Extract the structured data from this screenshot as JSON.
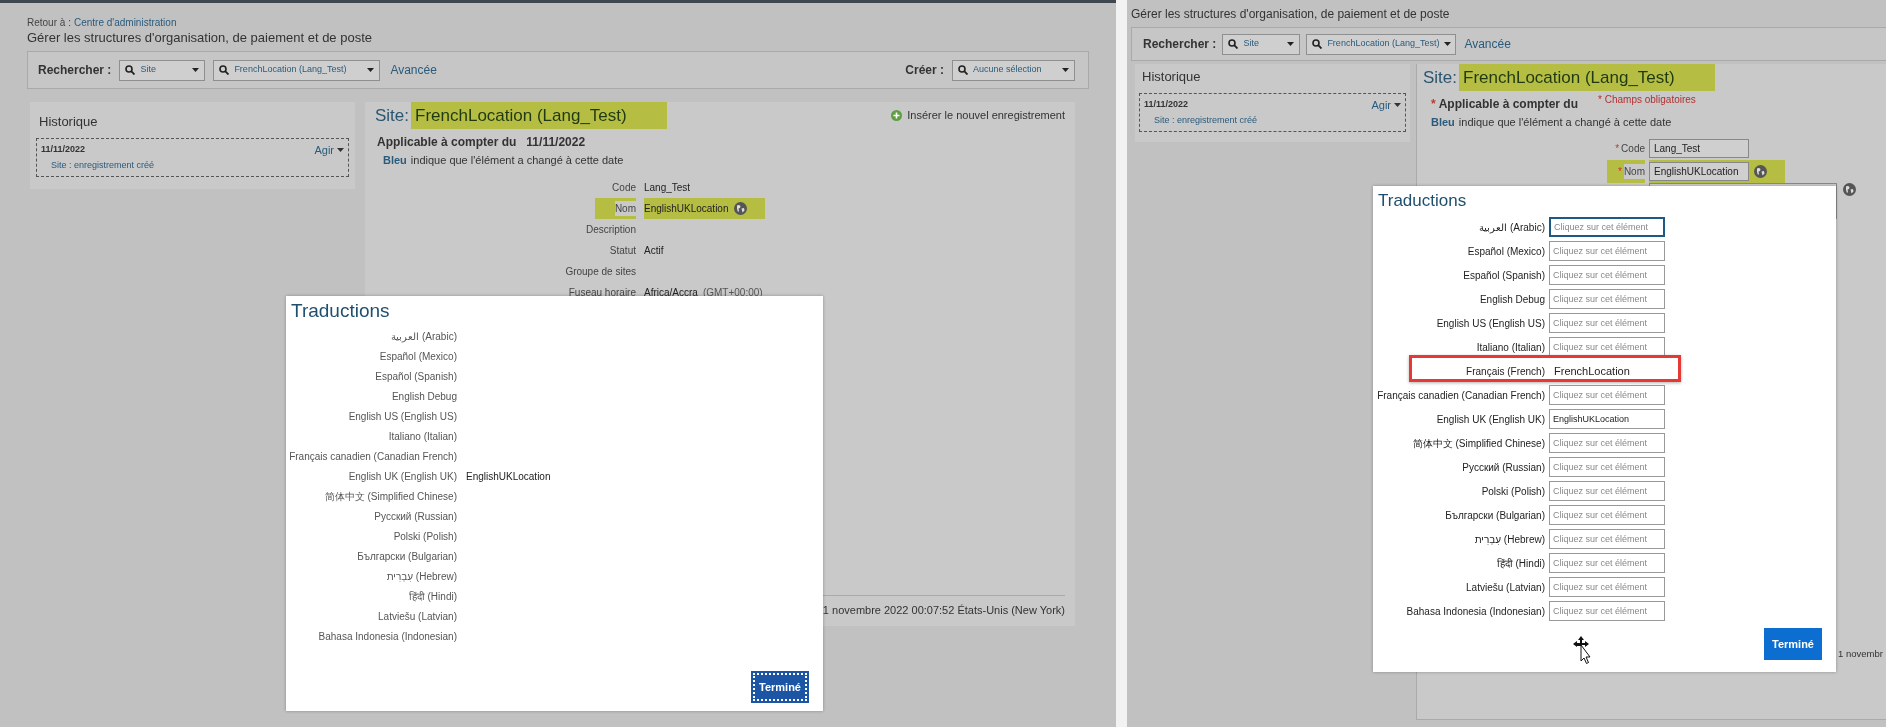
{
  "screenshots": [
    {
      "kind": "read_only",
      "breadcrumb": {
        "label": "Retour à :",
        "link": "Centre d'administration"
      },
      "page_title": "Gérer les structures d'organisation, de paiement et de poste",
      "search": {
        "label": "Rechercher :",
        "type_select": "Site",
        "record_select": "FrenchLocation (Lang_Test)",
        "advanced_link": "Avancée"
      },
      "create": {
        "label": "Créer :",
        "select": "Aucune sélection"
      },
      "history": {
        "title": "Historique",
        "entries": [
          {
            "date": "11/11/2022",
            "description": "Site : enregistrement créé",
            "action": "Agir"
          }
        ]
      },
      "record": {
        "title_prefix": "Site:",
        "title": "FrenchLocation (Lang_Test)",
        "insert_action": "Insérer le nouvel enregistrement",
        "effective": {
          "label": "Applicable à compter du",
          "date": "11/11/2022"
        },
        "legend": {
          "keyword": "Bleu",
          "text": "indique que l'élément a changé à cette date"
        },
        "fields": [
          {
            "kind": "text",
            "label": "Code",
            "value": "Lang_Test",
            "highlighted": false,
            "translatable": false
          },
          {
            "kind": "text",
            "label": "Nom",
            "value": "EnglishUKLocation",
            "highlighted": true,
            "translatable": true
          },
          {
            "kind": "text",
            "label": "Description",
            "highlighted": false,
            "translatable": false
          },
          {
            "kind": "text",
            "label": "Statut",
            "value": "Actif",
            "highlighted": false,
            "translatable": false
          },
          {
            "kind": "text",
            "label": "Groupe de sites",
            "highlighted": false,
            "translatable": false
          },
          {
            "kind": "text",
            "label": "Fuseau horaire",
            "value": "Africa/Accra",
            "note": "(GMT+00:00)",
            "highlighted": false,
            "translatable": false
          }
        ],
        "footer": "1 novembre 2022 00:07:52 États-Unis (New York)"
      },
      "translations": {
        "title": "Traductions",
        "done_button": "Terminé",
        "done_focused": true,
        "rows": [
          {
            "kind": "text",
            "language": "العربية (Arabic)"
          },
          {
            "kind": "text",
            "language": "Español (Mexico)"
          },
          {
            "kind": "text",
            "language": "Español (Spanish)"
          },
          {
            "kind": "text",
            "language": "English Debug"
          },
          {
            "kind": "text",
            "language": "English US (English US)"
          },
          {
            "kind": "text",
            "language": "Italiano (Italian)"
          },
          {
            "kind": "text",
            "language": "Français canadien (Canadian French)"
          },
          {
            "kind": "text",
            "language": "English UK (English UK)",
            "value": "EnglishUKLocation"
          },
          {
            "kind": "text",
            "language": "简体中文 (Simplified Chinese)"
          },
          {
            "kind": "text",
            "language": "Русский (Russian)"
          },
          {
            "kind": "text",
            "language": "Polski (Polish)"
          },
          {
            "kind": "text",
            "language": "Български (Bulgarian)"
          },
          {
            "kind": "text",
            "language": "עִבְרִית (Hebrew)"
          },
          {
            "kind": "text",
            "language": "हिंदी (Hindi)"
          },
          {
            "kind": "text",
            "language": "Latviešu (Latvian)"
          },
          {
            "kind": "text",
            "language": "Bahasa Indonesia (Indonesian)"
          }
        ]
      }
    },
    {
      "kind": "editing",
      "page_title": "Gérer les structures d'organisation, de paiement et de poste",
      "search": {
        "label": "Rechercher :",
        "type_select": "Site",
        "record_select": "FrenchLocation (Lang_Test)",
        "advanced_link": "Avancée"
      },
      "history": {
        "title": "Historique",
        "entries": [
          {
            "date": "11/11/2022",
            "description": "Site : enregistrement créé",
            "action": "Agir"
          }
        ]
      },
      "record": {
        "title_prefix": "Site:",
        "title": "FrenchLocation (Lang_Test)",
        "effective": {
          "mark": "*",
          "label": "Applicable à compter du"
        },
        "required_note": "* Champs obligatoires",
        "legend": {
          "keyword": "Bleu",
          "text": "indique que l'élément a changé à cette date"
        },
        "fields": [
          {
            "kind": "input",
            "mark": "*",
            "label": "Code",
            "value": "Lang_Test",
            "highlighted": false,
            "translatable": false
          },
          {
            "kind": "input",
            "mark": "*",
            "label": "Nom",
            "value": "EnglishUKLocation",
            "highlighted": true,
            "translatable": true
          },
          {
            "kind": "textarea",
            "highlighted": false,
            "translatable": true
          }
        ],
        "footer": "1 novembr"
      },
      "translations": {
        "title": "Traductions",
        "done_button": "Terminé",
        "done_focused": false,
        "rows": [
          {
            "kind": "input",
            "language": "العربية (Arabic)",
            "placeholder": "Cliquez sur cet élément",
            "focused": true,
            "highlighted": false
          },
          {
            "kind": "input",
            "language": "Español (Mexico)",
            "placeholder": "Cliquez sur cet élément",
            "focused": false,
            "highlighted": false
          },
          {
            "kind": "input",
            "language": "Español (Spanish)",
            "placeholder": "Cliquez sur cet élément",
            "focused": false,
            "highlighted": false
          },
          {
            "kind": "input",
            "language": "English Debug",
            "placeholder": "Cliquez sur cet élément",
            "focused": false,
            "highlighted": false
          },
          {
            "kind": "input",
            "language": "English US (English US)",
            "placeholder": "Cliquez sur cet élément",
            "focused": false,
            "highlighted": false
          },
          {
            "kind": "input",
            "language": "Italiano (Italian)",
            "placeholder": "Cliquez sur cet élément",
            "focused": false,
            "highlighted": false
          },
          {
            "kind": "text",
            "language": "Français (French)",
            "value": "FrenchLocation",
            "focused": false,
            "highlighted": true
          },
          {
            "kind": "input",
            "language": "Français canadien (Canadian French)",
            "placeholder": "Cliquez sur cet élément",
            "focused": false,
            "highlighted": false
          },
          {
            "kind": "input",
            "language": "English UK (English UK)",
            "value": "EnglishUKLocation",
            "focused": false,
            "highlighted": false
          },
          {
            "kind": "input",
            "language": "简体中文 (Simplified Chinese)",
            "placeholder": "Cliquez sur cet élément",
            "focused": false,
            "highlighted": false
          },
          {
            "kind": "input",
            "language": "Русский (Russian)",
            "placeholder": "Cliquez sur cet élément",
            "focused": false,
            "highlighted": false
          },
          {
            "kind": "input",
            "language": "Polski (Polish)",
            "placeholder": "Cliquez sur cet élément",
            "focused": false,
            "highlighted": false
          },
          {
            "kind": "input",
            "language": "Български (Bulgarian)",
            "placeholder": "Cliquez sur cet élément",
            "focused": false,
            "highlighted": false
          },
          {
            "kind": "input",
            "language": "עִבְרִית (Hebrew)",
            "placeholder": "Cliquez sur cet élément",
            "focused": false,
            "highlighted": false
          },
          {
            "kind": "input",
            "language": "हिंदी (Hindi)",
            "placeholder": "Cliquez sur cet élément",
            "focused": false,
            "highlighted": false
          },
          {
            "kind": "input",
            "language": "Latviešu (Latvian)",
            "placeholder": "Cliquez sur cet élément",
            "focused": false,
            "highlighted": false
          },
          {
            "kind": "input",
            "language": "Bahasa Indonesia (Indonesian)",
            "placeholder": "Cliquez sur cet élément",
            "focused": false,
            "highlighted": false
          }
        ]
      }
    }
  ]
}
